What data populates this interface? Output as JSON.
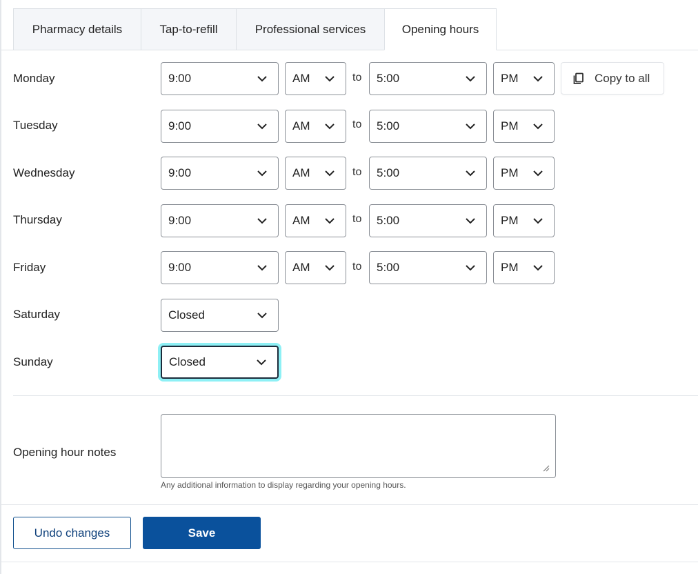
{
  "tabs": [
    {
      "label": "Pharmacy details",
      "active": false
    },
    {
      "label": "Tap-to-refill",
      "active": false
    },
    {
      "label": "Professional services",
      "active": false
    },
    {
      "label": "Opening hours",
      "active": true
    }
  ],
  "to_label": "to",
  "copy_to_all_label": "Copy to all",
  "days": [
    {
      "name": "Monday",
      "open_time": "9:00",
      "open_period": "AM",
      "close_time": "5:00",
      "close_period": "PM"
    },
    {
      "name": "Tuesday",
      "open_time": "9:00",
      "open_period": "AM",
      "close_time": "5:00",
      "close_period": "PM"
    },
    {
      "name": "Wednesday",
      "open_time": "9:00",
      "open_period": "AM",
      "close_time": "5:00",
      "close_period": "PM"
    },
    {
      "name": "Thursday",
      "open_time": "9:00",
      "open_period": "AM",
      "close_time": "5:00",
      "close_period": "PM"
    },
    {
      "name": "Friday",
      "open_time": "9:00",
      "open_period": "AM",
      "close_time": "5:00",
      "close_period": "PM"
    },
    {
      "name": "Saturday",
      "status": "Closed"
    },
    {
      "name": "Sunday",
      "status": "Closed"
    }
  ],
  "notes": {
    "label": "Opening hour notes",
    "value": "",
    "help": "Any additional information to display regarding your opening hours."
  },
  "actions": {
    "undo_label": "Undo changes",
    "save_label": "Save"
  },
  "colors": {
    "primary": "#0a519c",
    "focus_ring": "#8ef0f5",
    "tab_inactive_bg": "#f4f6f9"
  }
}
